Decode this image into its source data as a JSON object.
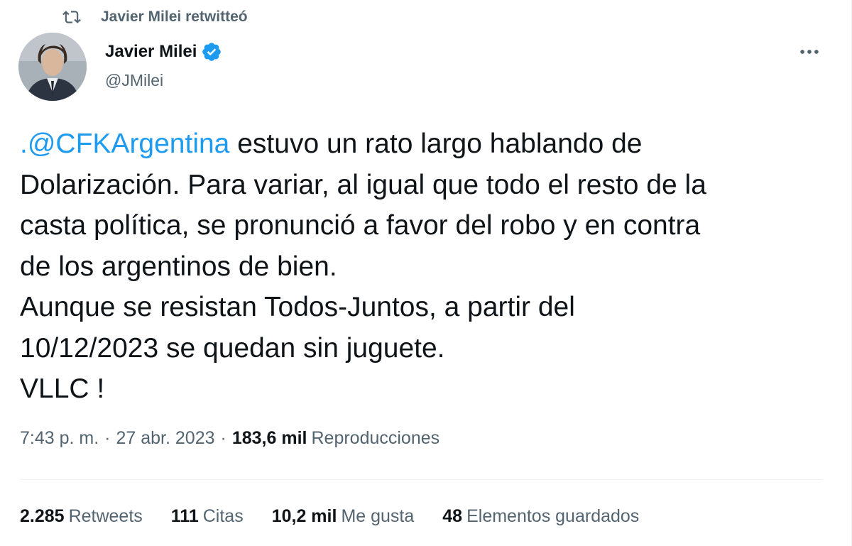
{
  "retweet_context": {
    "text": "Javier Milei retwitteó",
    "icon": "retweet-icon"
  },
  "author": {
    "name": "Javier Milei",
    "handle": "@JMilei",
    "verified_icon": "verified-badge-icon",
    "avatar": "avatar"
  },
  "more_icon": "more-options-icon",
  "tweet": {
    "mention": ".@CFKArgentina",
    "text_after_mention": " estuvo un rato largo hablando de\nDolarización. Para variar, al igual que todo el resto de la\ncasta política, se pronunció a favor del robo y en contra\nde los argentinos de bien.\nAunque se resistan Todos-Juntos, a partir del\n10/12/2023 se quedan sin juguete.\nVLLC !"
  },
  "meta": {
    "time": "7:43 p. m.",
    "separator": "·",
    "date": "27 abr. 2023",
    "views_count": "183,6 mil",
    "views_label": "Reproducciones"
  },
  "stats": [
    {
      "count": "2.285",
      "label": "Retweets"
    },
    {
      "count": "111",
      "label": "Citas"
    },
    {
      "count": "10,2 mil",
      "label": "Me gusta"
    },
    {
      "count": "48",
      "label": "Elementos guardados"
    }
  ],
  "colors": {
    "link": "#1d9bf0",
    "secondary_text": "#536471",
    "primary_text": "#0f1419",
    "divider": "#eff3f4"
  }
}
